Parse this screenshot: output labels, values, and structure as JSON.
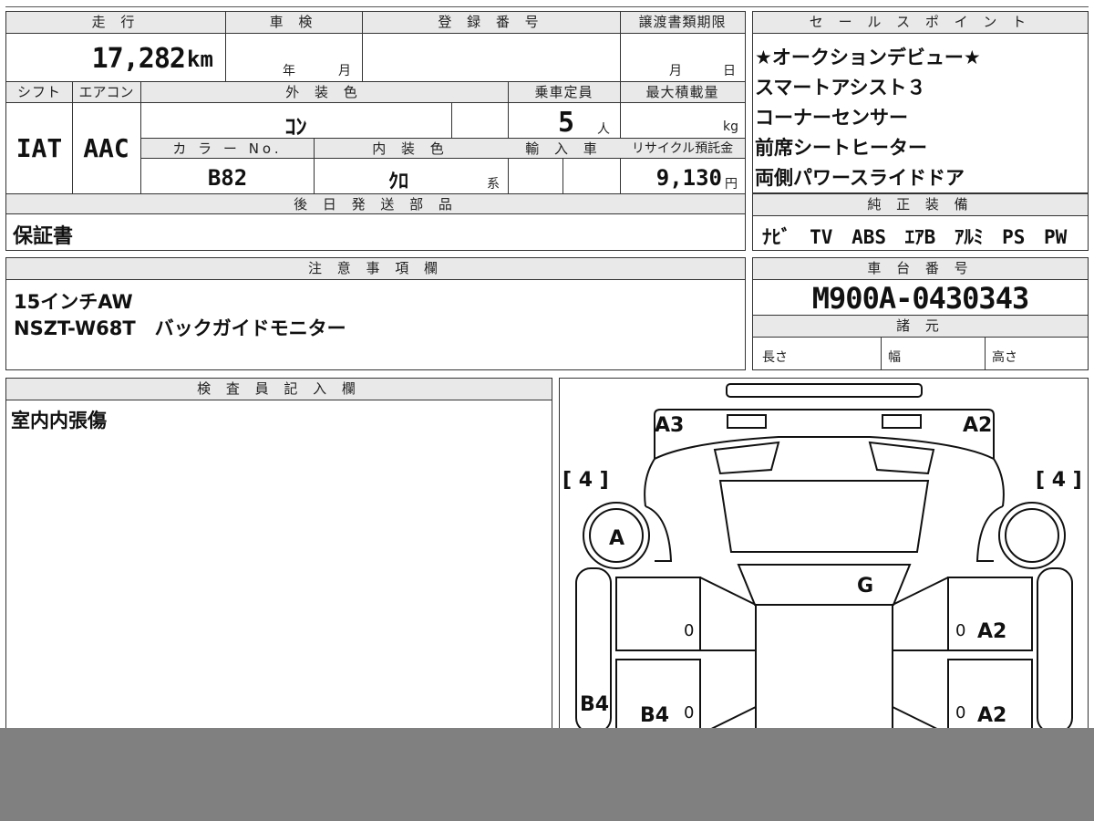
{
  "vehicle_info": {
    "headers": {
      "mileage": "走 行",
      "inspection": "車 検",
      "registration_no": "登 録 番 号",
      "transfer_deadline": "譲渡書類期限",
      "shift": "シフト",
      "aircon": "エアコン",
      "exterior_color": "外 装 色",
      "capacity": "乗車定員",
      "max_load": "最大積載量",
      "color_no": "カ ラ ー No.",
      "interior_color": "内 装 色",
      "import": "輸 入 車",
      "recycle_fee": "リサイクル預託金",
      "later_parts": "後 日 発 送 部 品"
    },
    "mileage": "17,282",
    "mileage_unit": "km",
    "inspection_year_unit": "年",
    "inspection_month_unit": "月",
    "deadline_month_unit": "月",
    "deadline_day_unit": "日",
    "shift": "IAT",
    "aircon": "AAC",
    "exterior_color": "ｺﾝ",
    "capacity": "5",
    "capacity_unit": "人",
    "max_load_unit": "kg",
    "color_no": "B82",
    "interior_color": "ｸﾛ",
    "interior_color_suffix": "系",
    "recycle_fee": "9,130",
    "recycle_unit": "円",
    "later_parts": "保証書"
  },
  "sales_points": {
    "header": "セ ー ル ス ポ イ ン ト",
    "items": [
      "★オークションデビュー★",
      "スマートアシスト３",
      "コーナーセンサー",
      "前席シートヒーター",
      "両側パワースライドドア"
    ]
  },
  "genuine_equipment": {
    "header": "純 正 装 備",
    "text": "ﾅﾋﾞ TV ABS ｴｱB ｱﾙﾐ PS PW"
  },
  "notes": {
    "header": "注 意 事 項 欄",
    "lines": [
      "15インチAW",
      "NSZT-W68T　バックガイドモニター"
    ]
  },
  "chassis": {
    "header": "車 台 番 号",
    "number": "M900A-0430343",
    "spec_header": "諸 元",
    "length_label": "長さ",
    "width_label": "幅",
    "height_label": "高さ"
  },
  "inspector": {
    "header": "検 査 員 記 入 欄",
    "comment": "室内内張傷"
  },
  "diagram": {
    "labels": {
      "front_left": "A3",
      "front_right": "A2",
      "tire_left": "[ 4 ]",
      "tire_right": "[ 4 ]",
      "wheel_left": "A",
      "roof": "G",
      "door_right_front": "A2",
      "door_right_rear": "A2",
      "pillar_left": "B4",
      "door_left_rear": "B4",
      "zero_1": "0",
      "zero_2": "0",
      "zero_3": "0",
      "zero_4": "0"
    }
  },
  "colors": {
    "border": "#333333",
    "header_bg": "#e9e9e9",
    "bottom_bar": "#808080"
  }
}
